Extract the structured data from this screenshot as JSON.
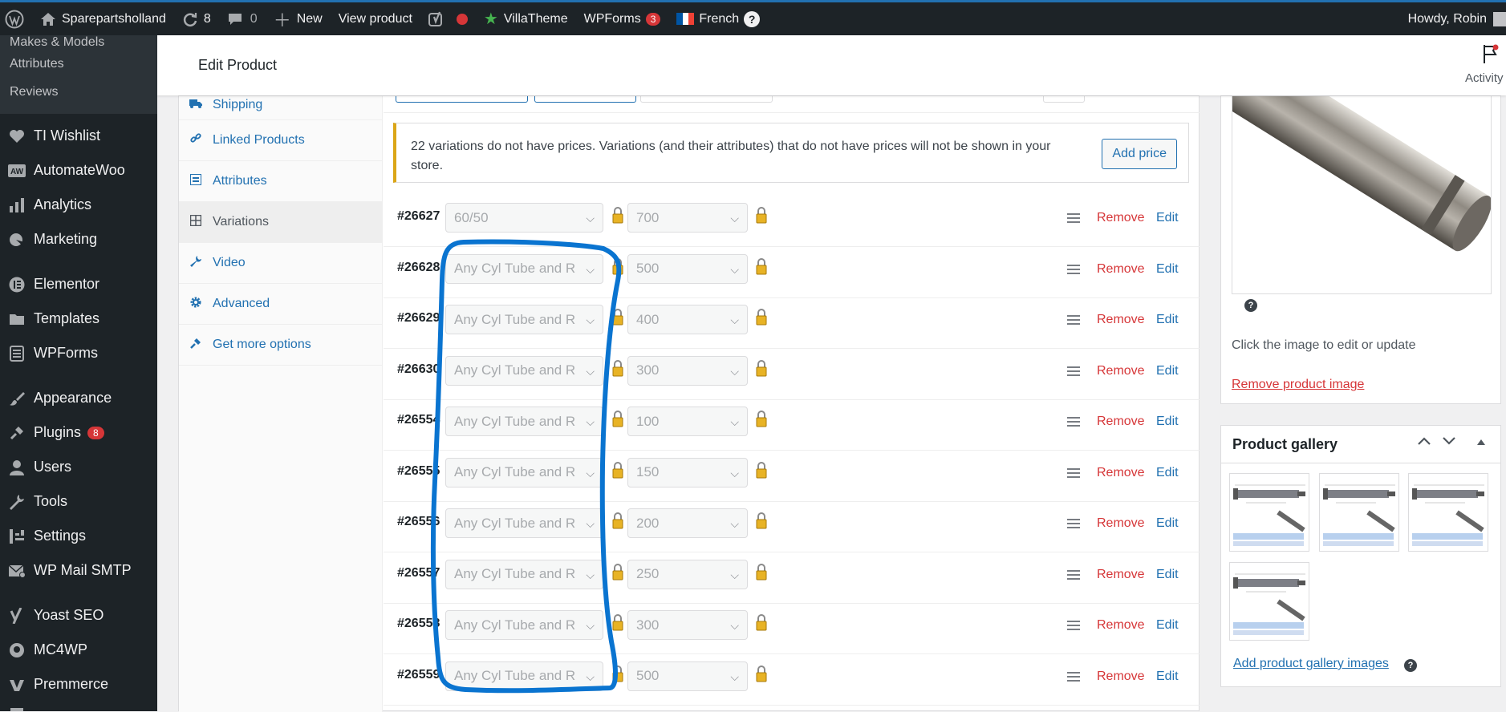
{
  "adminbar": {
    "site_name": "Sparepartsholland",
    "updates_count": "8",
    "comments_count": "0",
    "new_label": "New",
    "view_product_label": "View product",
    "villatheme_label": "VillaTheme",
    "wpforms_label": "WPForms",
    "wpforms_badge": "3",
    "language_label": "French",
    "help_glyph": "?",
    "howdy": "Howdy, Robin"
  },
  "sidebar": {
    "submenu": [
      "Makes & Models",
      "Attributes",
      "Reviews"
    ],
    "items": [
      {
        "label": "TI Wishlist",
        "icon": "heart-icon"
      },
      {
        "label": "AutomateWoo",
        "icon": "automatewoo-icon"
      },
      {
        "label": "Analytics",
        "icon": "bar-chart-icon"
      },
      {
        "label": "Marketing",
        "icon": "megaphone-icon"
      },
      {
        "label": "Elementor",
        "icon": "elementor-icon"
      },
      {
        "label": "Templates",
        "icon": "folder-icon"
      },
      {
        "label": "WPForms",
        "icon": "form-icon"
      },
      {
        "label": "Appearance",
        "icon": "paintbrush-icon"
      },
      {
        "label": "Plugins",
        "icon": "plug-icon",
        "badge": "8"
      },
      {
        "label": "Users",
        "icon": "user-icon"
      },
      {
        "label": "Tools",
        "icon": "wrench-icon"
      },
      {
        "label": "Settings",
        "icon": "settings-icon"
      },
      {
        "label": "WP Mail SMTP",
        "icon": "mail-icon"
      },
      {
        "label": "Yoast SEO",
        "icon": "yoast-icon"
      },
      {
        "label": "MC4WP",
        "icon": "mc4wp-icon"
      },
      {
        "label": "Premmerce",
        "icon": "premmerce-icon"
      }
    ]
  },
  "header": {
    "title": "Edit Product",
    "activity": "Activity"
  },
  "tabs": [
    {
      "label": "Shipping",
      "icon": "truck-icon"
    },
    {
      "label": "Linked Products",
      "icon": "link-icon"
    },
    {
      "label": "Attributes",
      "icon": "list-icon"
    },
    {
      "label": "Variations",
      "icon": "grid-icon",
      "active": true
    },
    {
      "label": "Video",
      "icon": "wrench-icon"
    },
    {
      "label": "Advanced",
      "icon": "gear-icon"
    },
    {
      "label": "Get more options",
      "icon": "plug-icon"
    }
  ],
  "notice": {
    "text": "22 variations do not have prices. Variations (and their attributes) that do not have prices will not be shown in your store.",
    "button": "Add price"
  },
  "variations": {
    "remove_label": "Remove",
    "edit_label": "Edit",
    "rows": [
      {
        "id": "#26627",
        "attr1": "60/50",
        "attr2": "700"
      },
      {
        "id": "#26628",
        "attr1": "Any Cyl Tube and R",
        "attr2": "500"
      },
      {
        "id": "#26629",
        "attr1": "Any Cyl Tube and R",
        "attr2": "400"
      },
      {
        "id": "#26630",
        "attr1": "Any Cyl Tube and R",
        "attr2": "300"
      },
      {
        "id": "#26554",
        "attr1": "Any Cyl Tube and R",
        "attr2": "100"
      },
      {
        "id": "#26555",
        "attr1": "Any Cyl Tube and R",
        "attr2": "150"
      },
      {
        "id": "#26556",
        "attr1": "Any Cyl Tube and R",
        "attr2": "200"
      },
      {
        "id": "#26557",
        "attr1": "Any Cyl Tube and R",
        "attr2": "250"
      },
      {
        "id": "#26558",
        "attr1": "Any Cyl Tube and R",
        "attr2": "300"
      },
      {
        "id": "#26559",
        "attr1": "Any Cyl Tube and R",
        "attr2": "500"
      }
    ]
  },
  "product_image": {
    "help_glyph": "?",
    "hint": "Click the image to edit or update",
    "remove_link": "Remove product image"
  },
  "gallery": {
    "title": "Product gallery",
    "add_link": "Add product gallery images",
    "help_glyph": "?",
    "thumb_count": 4
  },
  "colors": {
    "admin_bar": "#1d2327",
    "link": "#2271b1",
    "danger": "#d63638",
    "notice_border": "#dba617",
    "annotation": "#0a74d0"
  }
}
